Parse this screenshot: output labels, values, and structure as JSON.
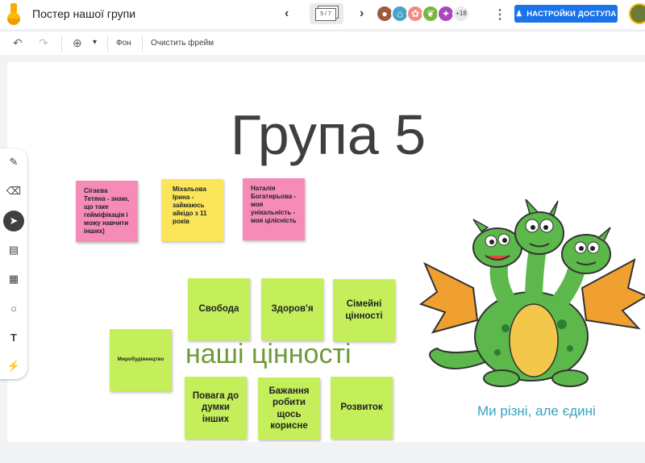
{
  "app": {
    "title": "Постер нашої групи",
    "frame_indicator": "5 / 7",
    "more_collaborators": "+18",
    "share_label": "НАСТРОЙКИ ДОСТУПА"
  },
  "toolbar": {
    "zoom_chevron": "▾",
    "background_label": "Фон",
    "clear_label": "Очистить фрейм"
  },
  "tools": [
    {
      "name": "pen",
      "glyph": "✎"
    },
    {
      "name": "eraser",
      "glyph": "⌫"
    },
    {
      "name": "select",
      "glyph": "➤"
    },
    {
      "name": "sticky-note",
      "glyph": "▤"
    },
    {
      "name": "image",
      "glyph": "▦"
    },
    {
      "name": "circle",
      "glyph": "○"
    },
    {
      "name": "text-box",
      "glyph": "T"
    },
    {
      "name": "laser",
      "glyph": "⚡"
    }
  ],
  "canvas": {
    "title": "Група 5",
    "notes": [
      {
        "text": "Сігаєва Тетяна - знаю, що таке гейміфікація і можу навчити інших)",
        "color": "pink"
      },
      {
        "text": "Міхальова Ірина - займаюсь айкідо з 11 років",
        "color": "yellow"
      },
      {
        "text": "Наталія Богатирьова - моя унікальність - моя цілісність",
        "color": "pink"
      }
    ],
    "values": [
      "Свобода",
      "Здоров'я",
      "Сімейні цінності",
      "Миробудівництво",
      "Повага до думки інших",
      "Бажання робити щось корисне",
      "Розвиток"
    ],
    "values_label": "наші цінності",
    "motto": "Ми різні, але єдині"
  },
  "colors": {
    "accent": "#1a73e8",
    "sticky_pink": "#f68bb7",
    "sticky_yellow": "#fbe55a",
    "sticky_green": "#c5ef5a",
    "values_text": "#6f9a3a",
    "motto_text": "#37a3c1",
    "title_text": "#3c4043"
  }
}
